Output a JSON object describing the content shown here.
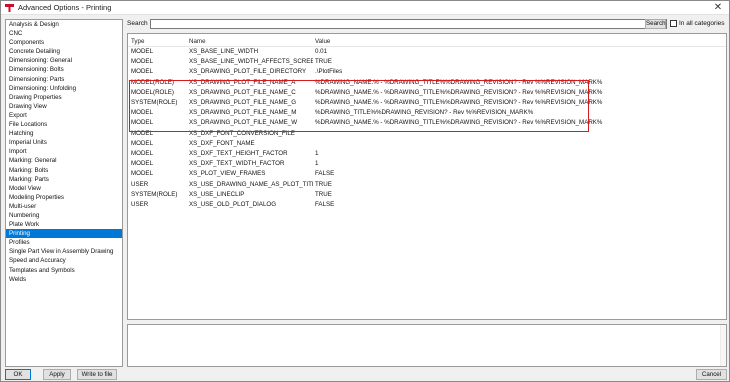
{
  "window": {
    "title": "Advanced Options - Printing",
    "close_glyph": "✕",
    "app_icon": "tekla-app-icon",
    "accent_color": "#0078d7",
    "highlight_color": "#d71a1a"
  },
  "sidebar": {
    "selected": "Printing",
    "items": [
      "Analysis & Design",
      "CNC",
      "Components",
      "Concrete Detailing",
      "Dimensioning: General",
      "Dimensioning: Bolts",
      "Dimensioning: Parts",
      "Dimensioning: Unfolding",
      "Drawing Properties",
      "Drawing View",
      "Export",
      "File Locations",
      "Hatching",
      "Imperial Units",
      "Import",
      "Marking: General",
      "Marking: Bolts",
      "Marking: Parts",
      "Model View",
      "Modeling Properties",
      "Multi-user",
      "Numbering",
      "Plate Work",
      "Printing",
      "Profiles",
      "Single Part View in Assembly Drawing",
      "Speed and Accuracy",
      "Templates and Symbols",
      "Welds"
    ]
  },
  "search": {
    "label": "Search",
    "value": "",
    "placeholder": "",
    "button_label": "Search",
    "in_all_categories_label": "In all categories",
    "in_all_categories_checked": false
  },
  "table": {
    "columns": {
      "type": "Type",
      "name": "Name",
      "value": "Value"
    },
    "rows": [
      {
        "type": "MODEL",
        "name": "XS_BASE_LINE_WIDTH",
        "value": "0.01"
      },
      {
        "type": "MODEL",
        "name": "XS_BASE_LINE_WIDTH_AFFECTS_SCREEN",
        "value": "TRUE"
      },
      {
        "type": "MODEL",
        "name": "XS_DRAWING_PLOT_FILE_DIRECTORY",
        "value": ".\\PlotFiles"
      },
      {
        "type": "MODEL(ROLE)",
        "name": "XS_DRAWING_PLOT_FILE_NAME_A",
        "value": "%DRAWING_NAME.% - %DRAWING_TITLE%%DRAWING_REVISION? - Rev %%REVISION_MARK%"
      },
      {
        "type": "MODEL(ROLE)",
        "name": "XS_DRAWING_PLOT_FILE_NAME_C",
        "value": "%DRAWING_NAME.% - %DRAWING_TITLE%%DRAWING_REVISION? - Rev %%REVISION_MARK%"
      },
      {
        "type": "SYSTEM(ROLE)",
        "name": "XS_DRAWING_PLOT_FILE_NAME_G",
        "value": "%DRAWING_NAME.% - %DRAWING_TITLE%%DRAWING_REVISION? - Rev %%REVISION_MARK%"
      },
      {
        "type": "MODEL",
        "name": "XS_DRAWING_PLOT_FILE_NAME_M",
        "value": "%DRAWING_TITLE%%DRAWING_REVISION? - Rev %%REVISION_MARK%"
      },
      {
        "type": "MODEL",
        "name": "XS_DRAWING_PLOT_FILE_NAME_W",
        "value": "%DRAWING_NAME.% - %DRAWING_TITLE%%DRAWING_REVISION? - Rev %%REVISION_MARK%"
      },
      {
        "type": "MODEL",
        "name": "XS_DXF_FONT_CONVERSION_FILE",
        "value": ""
      },
      {
        "type": "MODEL",
        "name": "XS_DXF_FONT_NAME",
        "value": ""
      },
      {
        "type": "MODEL",
        "name": "XS_DXF_TEXT_HEIGHT_FACTOR",
        "value": "1"
      },
      {
        "type": "MODEL",
        "name": "XS_DXF_TEXT_WIDTH_FACTOR",
        "value": "1"
      },
      {
        "type": "MODEL",
        "name": "XS_PLOT_VIEW_FRAMES",
        "value": "FALSE"
      },
      {
        "type": "USER",
        "name": "XS_USE_DRAWING_NAME_AS_PLOT_TITLE",
        "value": "TRUE"
      },
      {
        "type": "SYSTEM(ROLE)",
        "name": "XS_USE_LINECLIP",
        "value": "TRUE"
      },
      {
        "type": "USER",
        "name": "XS_USE_OLD_PLOT_DIALOG",
        "value": "FALSE"
      }
    ]
  },
  "buttons": {
    "ok": "OK",
    "apply": "Apply",
    "write_to_file": "Write to file",
    "cancel": "Cancel"
  }
}
